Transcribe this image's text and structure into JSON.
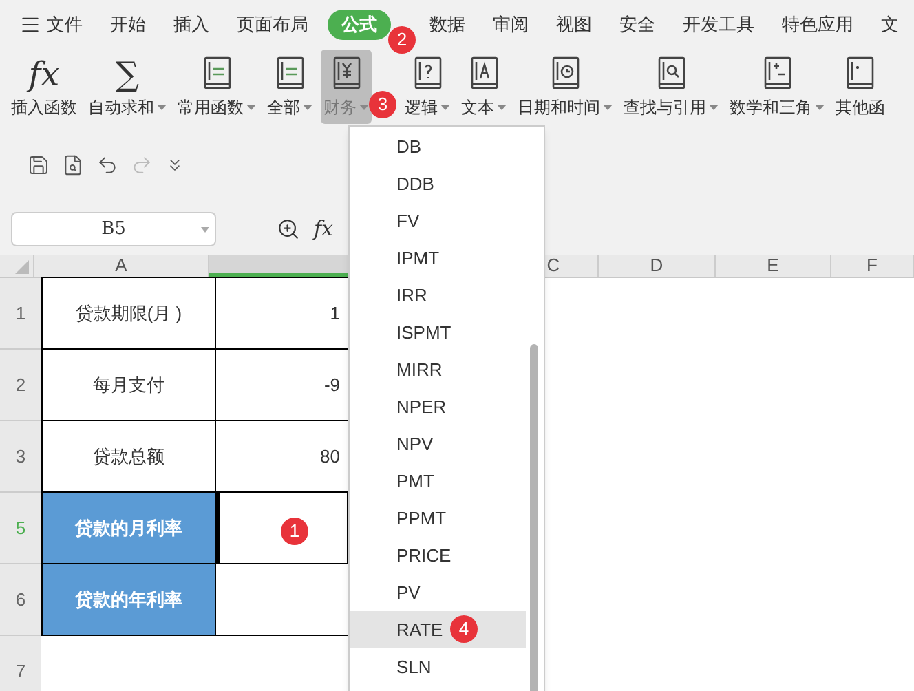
{
  "menu_bar": {
    "menu_label": "文件",
    "tabs": [
      {
        "label": "开始",
        "selected": false
      },
      {
        "label": "插入",
        "selected": false
      },
      {
        "label": "页面布局",
        "selected": false
      },
      {
        "label": "公式",
        "selected": true,
        "badge": "2"
      },
      {
        "label": "数据",
        "selected": false
      },
      {
        "label": "审阅",
        "selected": false
      },
      {
        "label": "视图",
        "selected": false
      },
      {
        "label": "安全",
        "selected": false
      },
      {
        "label": "开发工具",
        "selected": false
      },
      {
        "label": "特色应用",
        "selected": false
      },
      {
        "label": "文",
        "selected": false
      }
    ]
  },
  "ribbon": {
    "buttons": [
      {
        "label": "插入函数",
        "glyph": "fx",
        "dropdown": false,
        "selected": false
      },
      {
        "label": "自动求和",
        "glyph": "∑",
        "dropdown": true,
        "selected": false
      },
      {
        "label": "常用函数",
        "dropdown": true,
        "selected": false
      },
      {
        "label": "全部",
        "dropdown": true,
        "selected": false
      },
      {
        "label": "财务",
        "dropdown": true,
        "selected": true,
        "badge": "3"
      },
      {
        "label": "逻辑",
        "dropdown": true,
        "selected": false
      },
      {
        "label": "文本",
        "dropdown": true,
        "selected": false
      },
      {
        "label": "日期和时间",
        "dropdown": true,
        "selected": false
      },
      {
        "label": "查找与引用",
        "dropdown": true,
        "selected": false
      },
      {
        "label": "数学和三角",
        "dropdown": true,
        "selected": false
      },
      {
        "label": "其他函",
        "dropdown": false,
        "selected": false
      }
    ]
  },
  "formula_bar": {
    "name_box": "B5",
    "fx": "fx"
  },
  "sheet": {
    "columns": [
      {
        "label": "A",
        "selected": false
      },
      {
        "selected": true
      },
      {
        "label": "C",
        "selected": false
      },
      {
        "label": "D",
        "selected": false
      },
      {
        "label": "E",
        "selected": false
      },
      {
        "label": "F",
        "selected": false
      }
    ],
    "rows": [
      {
        "number": "1",
        "selected": false,
        "label": "贷款期限(月 )",
        "value": "1",
        "highlight": false
      },
      {
        "number": "2",
        "selected": false,
        "label": "每月支付",
        "value": "-9",
        "highlight": false
      },
      {
        "number": "3",
        "selected": false,
        "label": "贷款总额",
        "value": "80",
        "highlight": false
      },
      {
        "number": "5",
        "selected": true,
        "label": "贷款的月利率",
        "highlight": true,
        "badge": "1"
      },
      {
        "number": "6",
        "selected": false,
        "label": "贷款的年利率",
        "highlight": true
      },
      {
        "number": "7",
        "selected": false
      }
    ]
  },
  "dropdown": {
    "items": [
      {
        "label": "DB",
        "selected": false
      },
      {
        "label": "DDB",
        "selected": false
      },
      {
        "label": "FV",
        "selected": false
      },
      {
        "label": "IPMT",
        "selected": false
      },
      {
        "label": "IRR",
        "selected": false
      },
      {
        "label": "ISPMT",
        "selected": false
      },
      {
        "label": "MIRR",
        "selected": false
      },
      {
        "label": "NPER",
        "selected": false
      },
      {
        "label": "NPV",
        "selected": false
      },
      {
        "label": "PMT",
        "selected": false
      },
      {
        "label": "PPMT",
        "selected": false
      },
      {
        "label": "PRICE",
        "selected": false
      },
      {
        "label": "PV",
        "selected": false
      },
      {
        "label": "RATE",
        "selected": true,
        "badge": "4"
      },
      {
        "label": "SLN",
        "selected": false
      }
    ]
  }
}
